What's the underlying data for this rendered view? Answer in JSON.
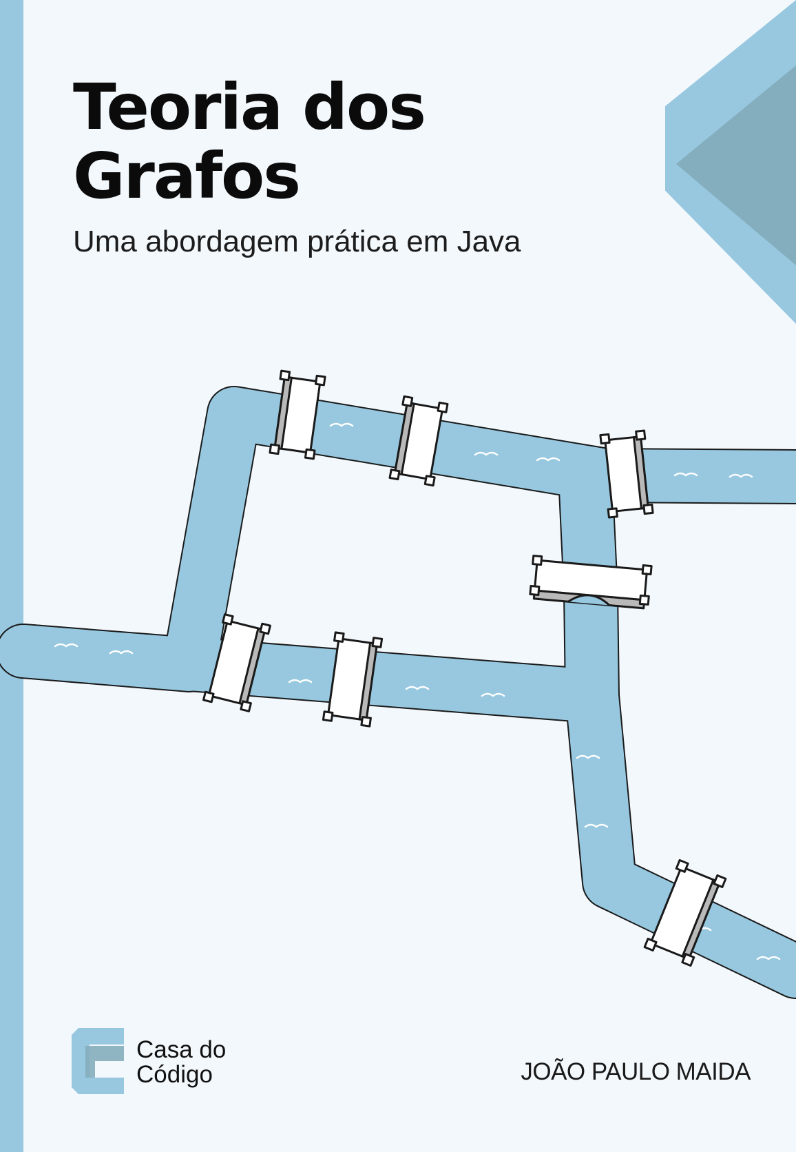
{
  "book": {
    "title_line1": "Teoria dos",
    "title_line2": "Grafos",
    "subtitle": "Uma abordagem prática em Java",
    "author": "JOÃO PAULO MAIDA"
  },
  "publisher": {
    "line1": "Casa do",
    "line2": "Código"
  },
  "colors": {
    "background": "#f3f8fc",
    "accent_blue": "#97c8df",
    "dark_accent": "#84adbd",
    "text": "#0b0b0b"
  }
}
